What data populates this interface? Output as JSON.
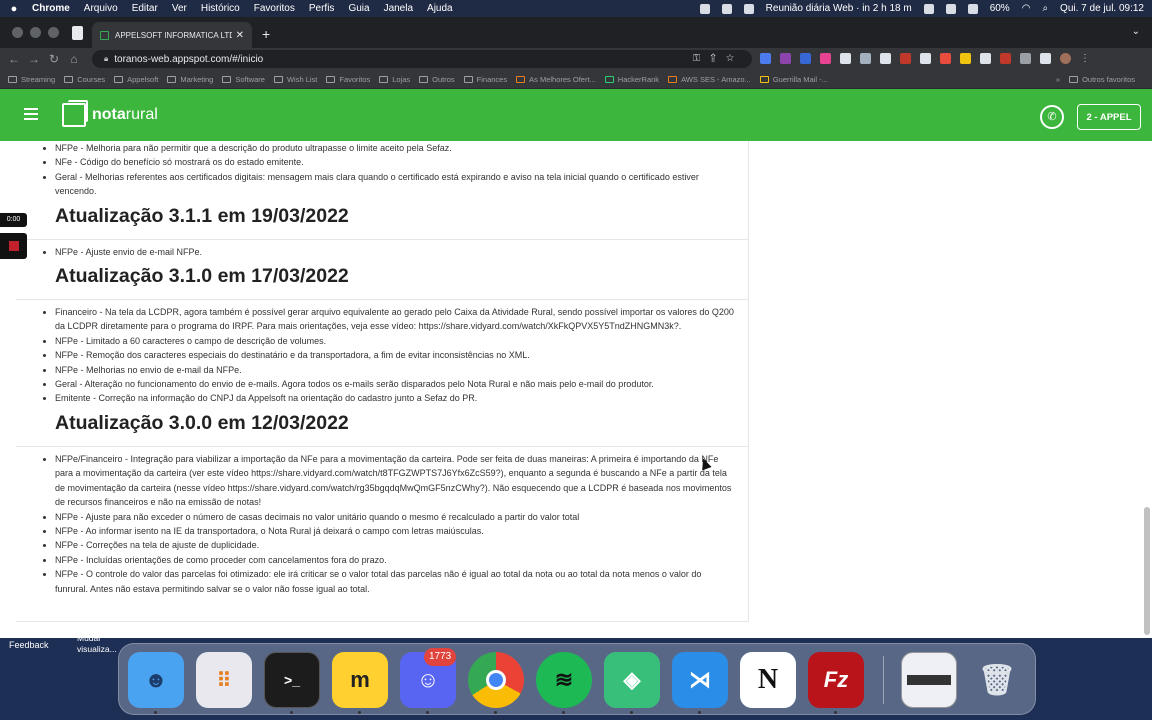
{
  "menubar": {
    "app": "Chrome",
    "items": [
      "Arquivo",
      "Editar",
      "Ver",
      "Histórico",
      "Favoritos",
      "Perfis",
      "Guia",
      "Janela",
      "Ajuda"
    ],
    "meeting": "Reunião diária Web · in 2 h 18 m",
    "battery": "60%",
    "datetime": "Qui. 7 de jul.  09:12"
  },
  "browser": {
    "tab_title": "APPELSOFT INFORMATICA LTDA",
    "url": "toranos-web.appspot.com/#/inicio",
    "bookmarks": [
      "Streaming",
      "Courses",
      "Appelsoft",
      "Marketing",
      "Software",
      "Wish List",
      "Favoritos",
      "Lojas",
      "Outros",
      "Finances",
      "As Melhores Ofert...",
      "HackerRank",
      "AWS SES - Amazo...",
      "Guerrilla Mail -..."
    ],
    "other_bookmarks": "Outros favoritos"
  },
  "app": {
    "logo_bold": "nota",
    "logo_italic": "rural",
    "user_button": "2 - APPEL"
  },
  "content": {
    "top_items": [
      "NFPe - Melhoria para não permitir que a descrição do produto ultrapasse o limite aceito pela Sefaz.",
      "NFe - Código do benefício só mostrará os do estado emitente.",
      "Geral - Melhorias referentes aos certificados digitais: mensagem mais clara quando o certificado está expirando e aviso na tela inicial quando o certificado estiver vencendo."
    ],
    "sections": [
      {
        "title": "Atualização 3.1.1 em 19/03/2022",
        "items": [
          "NFPe - Ajuste envio de e-mail NFPe."
        ]
      },
      {
        "title": "Atualização 3.1.0 em 17/03/2022",
        "items": [
          "Financeiro - Na tela da LCDPR, agora também é possível gerar arquivo equivalente ao gerado pelo Caixa da Atividade Rural, sendo possível importar os valores do Q200 da LCDPR diretamente para o programa do IRPF. Para mais orientações, veja esse vídeo: https://share.vidyard.com/watch/XkFkQPVX5Y5TndZHNGMN3k?.",
          "NFPe - Limitado a 60 caracteres o campo de descrição de volumes.",
          "NFPe - Remoção dos caracteres especiais do destinatário e da transportadora, a fim de evitar inconsistências no XML.",
          "NFPe - Melhorias no envio de e-mail da NFPe.",
          "Geral - Alteração no funcionamento do envio de e-mails. Agora todos os e-mails serão disparados pelo Nota Rural e não mais pelo e-mail do produtor.",
          "Emitente - Correção na informação do CNPJ da Appelsoft na orientação do cadastro junto a Sefaz do PR."
        ]
      },
      {
        "title": "Atualização 3.0.0 em 12/03/2022",
        "items": [
          "NFPe/Financeiro - Integração para viabilizar a importação da NFe para a movimentação da carteira. Pode ser feita de duas maneiras: A primeira é importando da NFe para a movimentação da carteira (ver este vídeo https://share.vidyard.com/watch/t8TFGZWPTS7J6Yfx6ZcS59?), enquanto a segunda é buscando a NFe a partir da tela de movimentação da carteira (nesse vídeo https://share.vidyard.com/watch/rg35bgqdqMwQmGF5nzCWhy?). Não esquecendo que a LCDPR é baseada nos movimentos de recursos financeiros e não na emissão de notas!",
          "NFPe - Ajuste para não exceder o número de casas decimais no valor unitário quando o mesmo é recalculado a partir do valor total",
          "NFPe - Ao informar isento na IE da transportadora, o Nota Rural já deixará o campo com letras maiúsculas.",
          "NFPe - Correções na tela de ajuste de duplicidade.",
          "NFPe - Incluídas orientações de como proceder com cancelamentos fora do prazo.",
          "NFPe - O controle do valor das parcelas foi otimizado: ele irá criticar se o valor total das parcelas não é igual ao total da nota ou ao total da nota menos o valor do funrural. Antes não estava permitindo salvar se o valor não fosse igual ao total."
        ]
      }
    ]
  },
  "recording": {
    "time": "0:00"
  },
  "footer": {
    "feedback": "Feedback",
    "mudar_line1": "Mudar",
    "mudar_line2": "visualiza..."
  },
  "dock": {
    "apps": [
      {
        "name": "finder",
        "color": "#4aa3f0"
      },
      {
        "name": "launchpad",
        "color": "#e8e8ee"
      },
      {
        "name": "terminal",
        "color": "#1c1c1c",
        "glyph": ">_"
      },
      {
        "name": "miro",
        "color": "#ffd02f",
        "glyph": "m"
      },
      {
        "name": "discord",
        "color": "#5865f2",
        "glyph": "☺",
        "badge": "1773"
      },
      {
        "name": "chrome",
        "color": "#ffffff"
      },
      {
        "name": "spotify",
        "color": "#1db954",
        "glyph": "≋"
      },
      {
        "name": "appelsoft",
        "color": "#38c07a",
        "glyph": "◈"
      },
      {
        "name": "vscode",
        "color": "#2a8ee8",
        "glyph": "⋊"
      },
      {
        "name": "notion",
        "color": "#ffffff",
        "glyph": "N"
      },
      {
        "name": "filezilla",
        "color": "#b8141a",
        "glyph": "Fz"
      }
    ]
  }
}
